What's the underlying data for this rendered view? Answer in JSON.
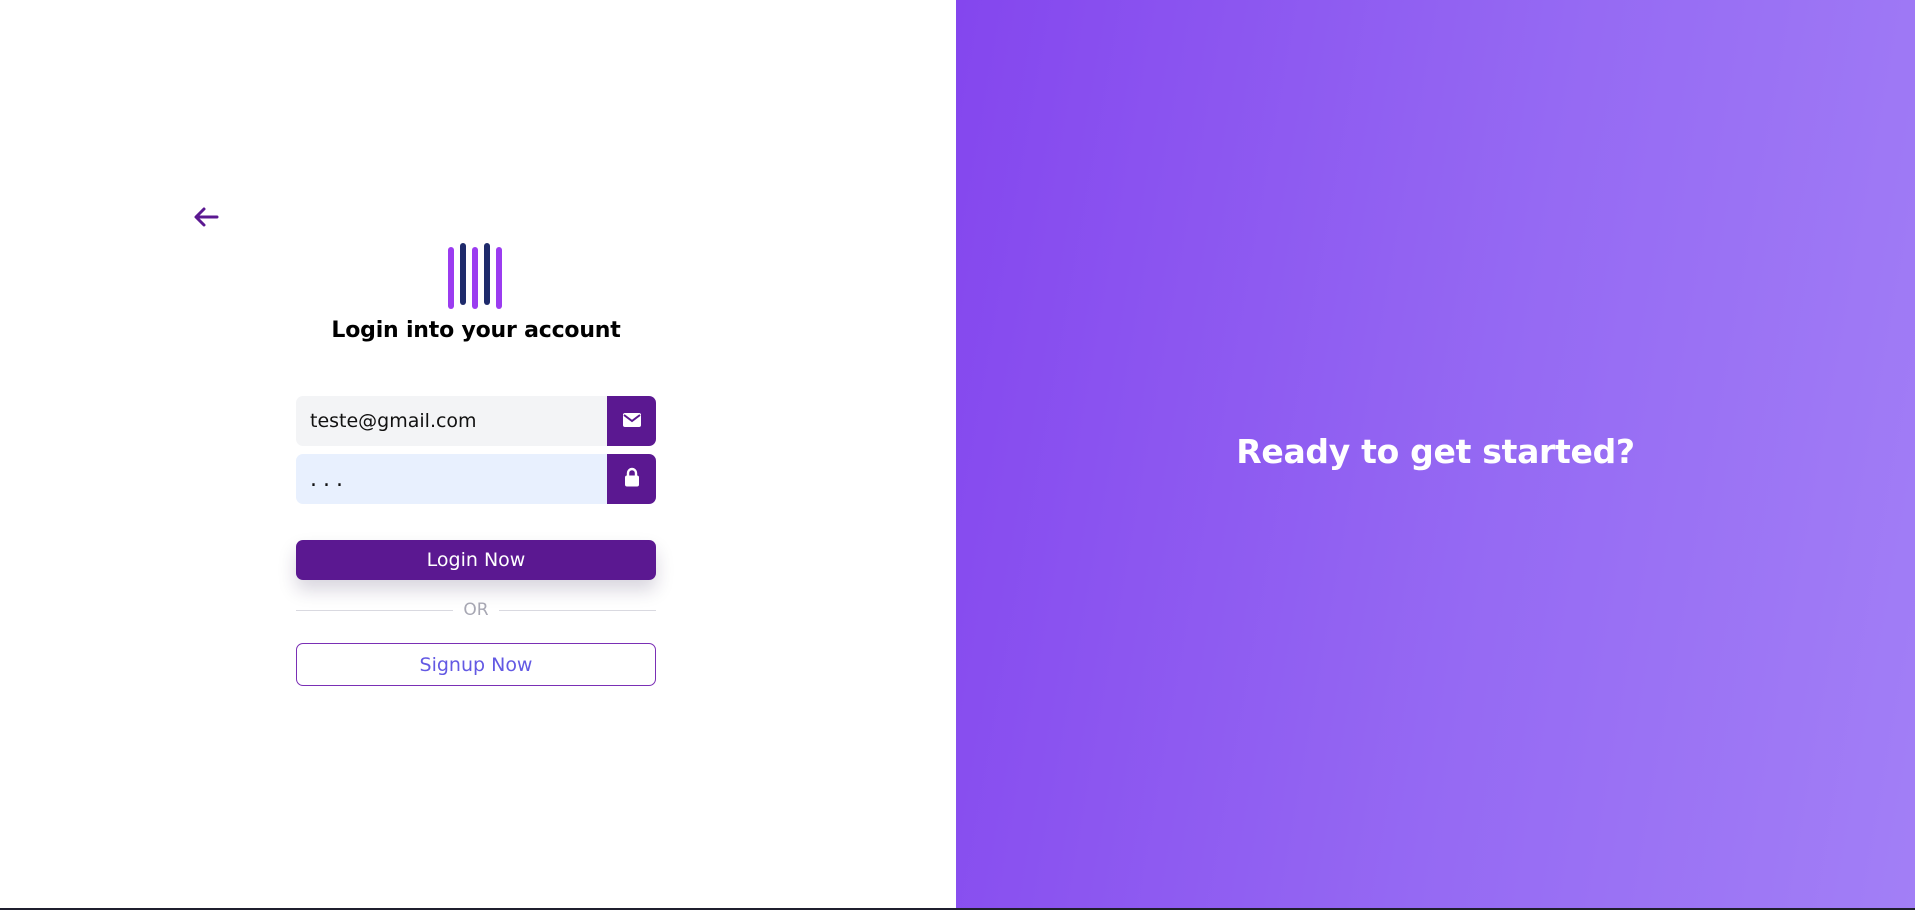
{
  "login": {
    "back_icon": "arrow-left-icon",
    "logo_icon": "bars-logo-icon",
    "title": "Login into your account",
    "email": {
      "value": "teste@gmail.com",
      "icon": "envelope-icon"
    },
    "password": {
      "value": "...",
      "icon": "lock-icon"
    },
    "login_button_label": "Login Now",
    "divider_label": "OR",
    "signup_button_label": "Signup Now"
  },
  "promo": {
    "headline": "Ready to get started?"
  },
  "colors": {
    "brand": "#5b1891",
    "gradient_start": "#8446ee",
    "gradient_end": "#a27ff6",
    "signup_text": "#6359e3",
    "logo_light": "#9b3cf0",
    "logo_dark": "#1e2a6b"
  }
}
